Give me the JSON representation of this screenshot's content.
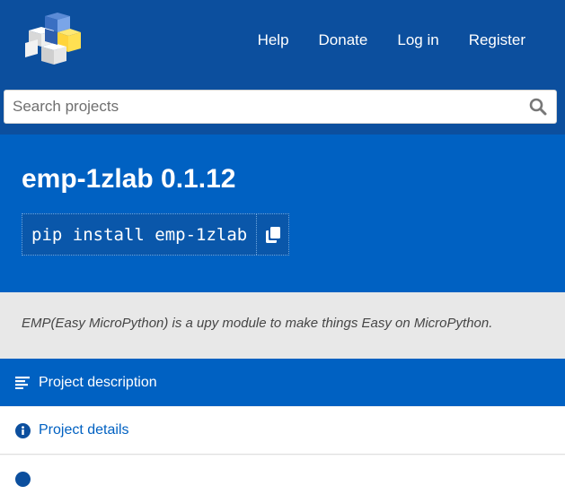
{
  "header": {
    "nav": [
      "Help",
      "Donate",
      "Log in",
      "Register"
    ]
  },
  "search": {
    "placeholder": "Search projects"
  },
  "package": {
    "title": "emp-1zlab 0.1.12",
    "pip_command": "pip install emp-1zlab"
  },
  "summary": "EMP(Easy MicroPython) is a upy module to make things Easy on MicroPython.",
  "tabs": [
    {
      "label": "Project description",
      "icon": "align-left-icon"
    },
    {
      "label": "Project details",
      "icon": "info-icon"
    }
  ],
  "colors": {
    "header": "#0c4f9e",
    "banner": "#0061c2",
    "summary_bg": "#e8e8e8",
    "link": "#0061c2"
  }
}
